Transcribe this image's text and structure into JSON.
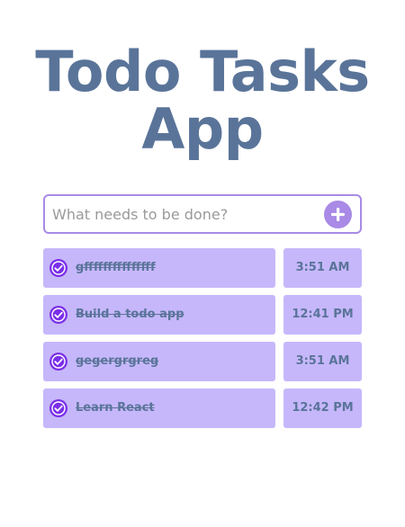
{
  "app": {
    "title_line1": "Todo Tasks",
    "title_line2": "App"
  },
  "new_todo": {
    "placeholder": "What needs to be done?",
    "value": "",
    "add_icon": "plus-icon"
  },
  "todos": [
    {
      "text": "gfffffffffffffff",
      "time": "3:51 AM",
      "completed": true,
      "icon": "check-circle-icon"
    },
    {
      "text": "Build a todo app",
      "time": "12:41 PM",
      "completed": true,
      "icon": "check-circle-icon"
    },
    {
      "text": "gegergrgreg",
      "time": "3:51 AM",
      "completed": true,
      "icon": "check-circle-icon"
    },
    {
      "text": "Learn React",
      "time": "12:42 PM",
      "completed": true,
      "icon": "check-circle-icon"
    }
  ],
  "colors": {
    "title": "#5a7499",
    "accent": "#a98ae6",
    "item_background": "#c6b7fb",
    "check": "#7b2fe8"
  }
}
